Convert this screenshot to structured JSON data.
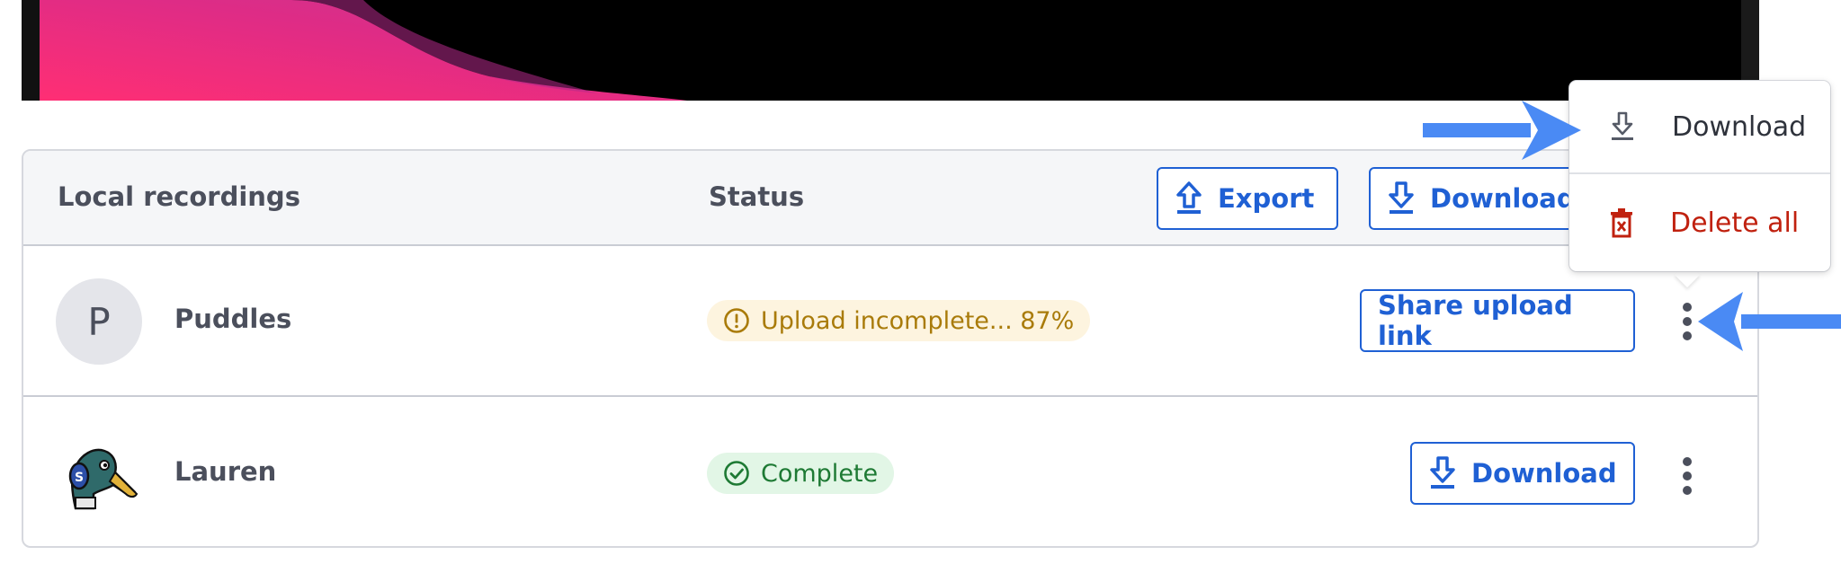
{
  "table": {
    "headers": {
      "recordings": "Local recordings",
      "status": "Status"
    },
    "toolbar": {
      "export_label": "Export",
      "download_label": "Download"
    },
    "rows": [
      {
        "avatar_initial": "P",
        "name": "Puddles",
        "status": "Upload incomplete... 87%",
        "status_icon": "alert-circle-icon",
        "action_label": "Share upload link"
      },
      {
        "avatar_icon": "duck-avatar",
        "name": "Lauren",
        "status": "Complete",
        "status_icon": "check-circle-icon",
        "action_label": "Download"
      }
    ]
  },
  "menu": {
    "download_label": "Download",
    "delete_label": "Delete all"
  },
  "colors": {
    "accent": "#1f60d4",
    "annotation_arrow": "#4a8af4",
    "warning_bg": "#fdf4df",
    "warning_text": "#a97b0a",
    "success_bg": "#e2f6e6",
    "success_text": "#1e7a34",
    "danger": "#c0210f"
  }
}
